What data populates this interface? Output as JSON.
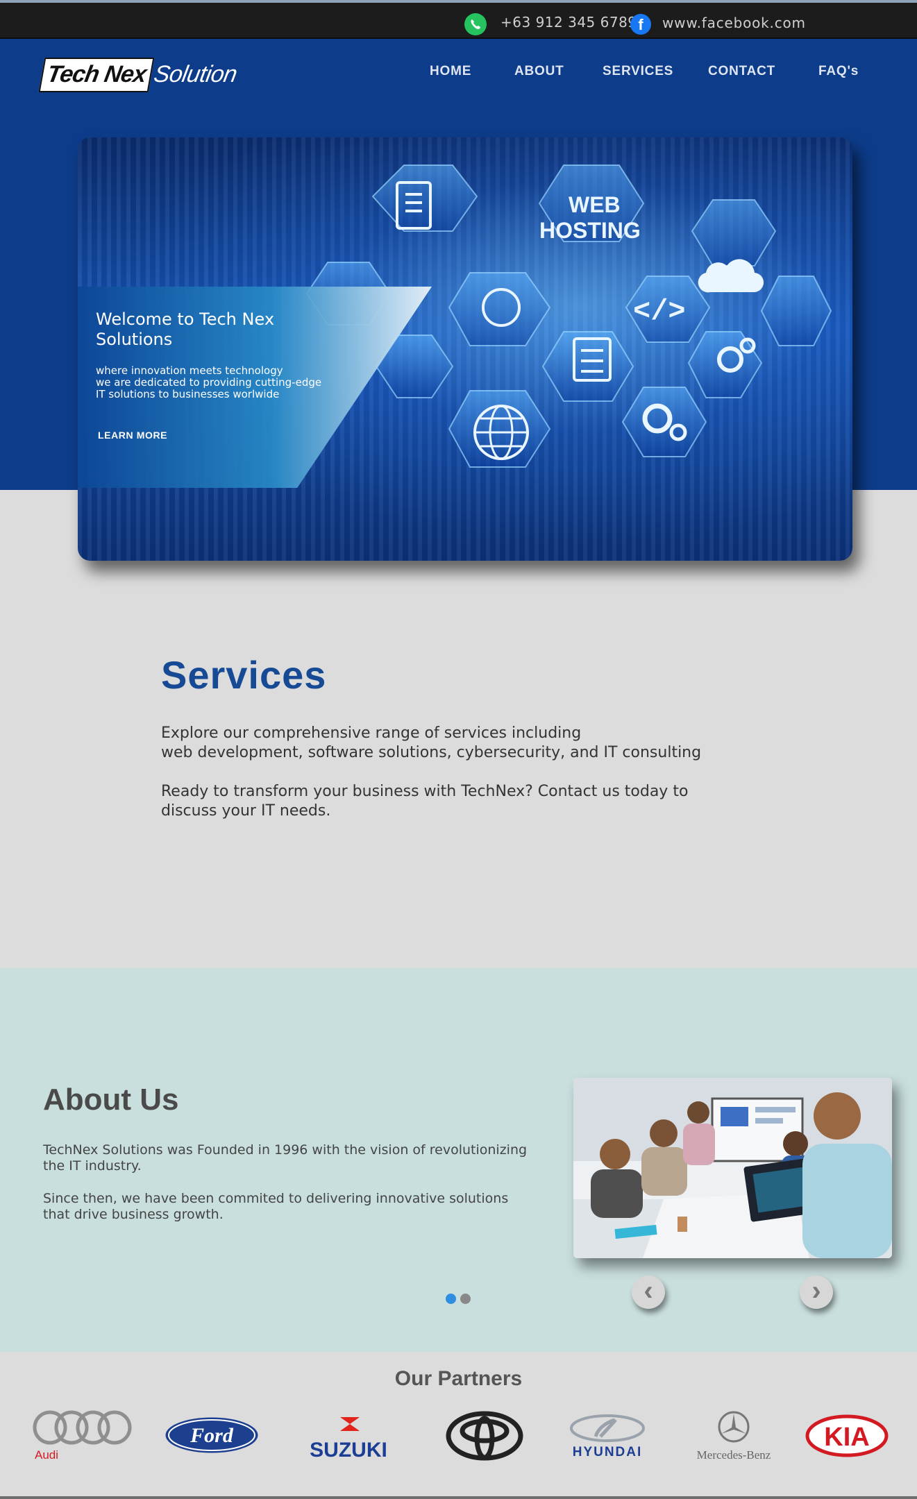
{
  "topbar": {
    "phone": "+63 912 345 6789",
    "facebook": "www.facebook.com",
    "whatsapp_icon": "whatsapp-icon",
    "facebook_icon": "facebook-icon"
  },
  "header": {
    "logo_part1": "Tech Nex",
    "logo_part2": "Solution",
    "nav": [
      "HOME",
      "ABOUT",
      "SERVICES",
      "CONTACT",
      "FAQ's"
    ]
  },
  "hero": {
    "title": "Welcome to Tech Nex Solutions",
    "subtitle_lines": [
      "where innovation  meets technology",
      "we are dedicated to providing cutting-edge",
      "IT solutions to businesses worlwide"
    ],
    "button": "LEARN MORE",
    "image_labels": [
      "WEB",
      "HOSTING",
      "</>"
    ]
  },
  "services": {
    "title": "Services",
    "p1_lines": [
      "Explore our comprehensive range of services including",
      "web development, software solutions, cybersecurity, and IT consulting"
    ],
    "p2_lines": [
      "Ready to transform your business with TechNex? Contact us today to",
      "discuss your IT needs."
    ]
  },
  "about": {
    "title": "About Us",
    "p1_lines": [
      "TechNex Solutions was Founded in 1996 with the vision of revolutionizing",
      "the IT industry."
    ],
    "p2_lines": [
      "Since then, we have been commited to delivering innovative solutions",
      "that drive business growth."
    ],
    "carousel": {
      "active_index": 0,
      "count": 2,
      "prev_icon": "chevron-left-icon",
      "next_icon": "chevron-right-icon"
    }
  },
  "partners": {
    "title": "Our Partners",
    "logos": [
      "Audi",
      "Ford",
      "SUZUKI",
      "Toyota",
      "HYUNDAI",
      "Mercedes-Benz",
      "KIA"
    ]
  },
  "colors": {
    "header_blue": "#0d3c8a",
    "title_blue": "#174a94",
    "about_bg": "#c9dfde",
    "page_bg": "#dcdcdc",
    "dot_active": "#2e8ee0",
    "dot_inactive": "#888888"
  }
}
